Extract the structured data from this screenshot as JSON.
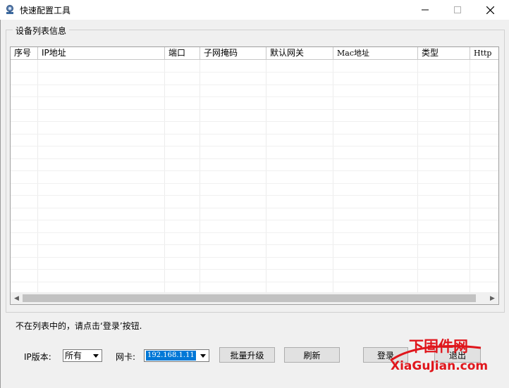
{
  "window": {
    "title": "快速配置工具",
    "icon": "app-tool-icon",
    "controls": [
      "minimize-icon",
      "maximize-icon",
      "close-icon"
    ]
  },
  "device_list": {
    "group_label": "设备列表信息",
    "columns": [
      "序号",
      "IP地址",
      "端口",
      "子网掩码",
      "默认网关",
      "Mac地址",
      "类型",
      "Http"
    ],
    "rows": []
  },
  "hint": "不在列表中的，请点击‘登录’按钮.",
  "controls": {
    "ip_version_label": "IP版本:",
    "ip_version_value": "所有",
    "nic_label": "网卡:",
    "nic_value": "192.168.1.11",
    "batch_upgrade": "批量升级",
    "refresh": "刷新",
    "login": "登录",
    "exit": "退出"
  },
  "watermark": {
    "cn": "下固件网",
    "en": "XiaGuJian.com"
  },
  "colors": {
    "selection": "#0078d7",
    "watermark": "#e0161c"
  }
}
